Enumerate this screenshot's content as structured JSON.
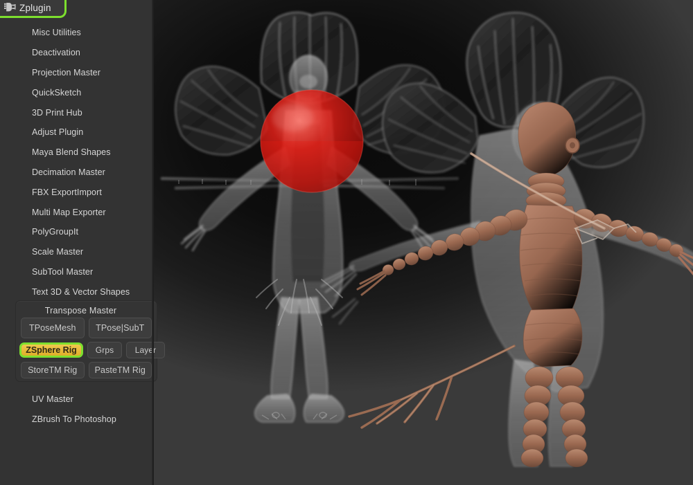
{
  "app": {
    "name": "ZBrush",
    "palette_title": "Zplugin",
    "palette_icon": "plug-icon",
    "highlight_color": "#7ddf2e",
    "active_button_color": "#e8b838",
    "sidebar_bg": "#333333"
  },
  "menu": {
    "items_top": [
      {
        "label": "Misc Utilities"
      },
      {
        "label": "Deactivation"
      },
      {
        "label": "Projection Master"
      },
      {
        "label": "QuickSketch"
      },
      {
        "label": "3D Print Hub"
      },
      {
        "label": "Adjust Plugin"
      },
      {
        "label": "Maya Blend Shapes"
      },
      {
        "label": "Decimation Master"
      },
      {
        "label": "FBX ExportImport"
      },
      {
        "label": "Multi Map Exporter"
      },
      {
        "label": "PolyGroupIt"
      },
      {
        "label": "Scale Master"
      },
      {
        "label": "SubTool Master"
      },
      {
        "label": "Text 3D & Vector Shapes"
      }
    ],
    "items_bottom": [
      {
        "label": "UV Master"
      },
      {
        "label": "ZBrush To Photoshop"
      }
    ]
  },
  "transpose_master": {
    "title": "Transpose Master",
    "row1": [
      {
        "label": "TPoseMesh"
      },
      {
        "label": "TPose|SubT"
      }
    ],
    "zsphere_rig": {
      "label": "ZSphere Rig",
      "selected": true
    },
    "grps": {
      "label": "Grps"
    },
    "layer": {
      "label": "Layer"
    },
    "row3": [
      {
        "label": "StoreTM Rig"
      },
      {
        "label": "PasteTM Rig"
      }
    ]
  },
  "viewport": {
    "label": "3d-viewport",
    "background_color": "#0d0d0d",
    "models": [
      {
        "name": "ghost-creature-front",
        "render_style": "transparent-ghost",
        "color": "#b8b8b8"
      },
      {
        "name": "ghost-creature-side",
        "render_style": "transparent-ghost",
        "color": "#b0b0b0"
      },
      {
        "name": "zsphere-rig",
        "render_style": "clay",
        "color": "#9a6b52"
      }
    ],
    "transpose_gizmo": {
      "name": "red-selection-sphere",
      "color": "#cc1111"
    }
  }
}
